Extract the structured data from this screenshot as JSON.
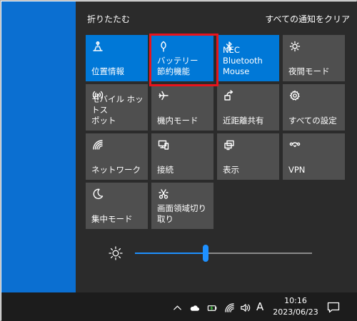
{
  "header": {
    "collapse_label": "折りたたむ",
    "clear_all_label": "すべての通知をクリア"
  },
  "tiles": [
    {
      "label": "位置情報",
      "icon": "location-icon",
      "active": true
    },
    {
      "label": "バッテリー\n節約機能",
      "icon": "battery-saver-icon",
      "active": true
    },
    {
      "label": "NEC Bluetooth\nMouse",
      "icon": "bluetooth-icon",
      "active": true
    },
    {
      "label": "夜間モード",
      "icon": "night-light-icon",
      "active": false
    },
    {
      "label": "モバイル ホットス\nポット",
      "icon": "mobile-hotspot-icon",
      "active": false
    },
    {
      "label": "機内モード",
      "icon": "airplane-icon",
      "active": false
    },
    {
      "label": "近距離共有",
      "icon": "nearby-share-icon",
      "active": false
    },
    {
      "label": "すべての設定",
      "icon": "settings-gear-icon",
      "active": false
    },
    {
      "label": "ネットワーク",
      "icon": "network-icon",
      "active": false
    },
    {
      "label": "接続",
      "icon": "connect-icon",
      "active": false
    },
    {
      "label": "表示",
      "icon": "project-icon",
      "active": false
    },
    {
      "label": "VPN",
      "icon": "vpn-icon",
      "active": false
    },
    {
      "label": "集中モード",
      "icon": "focus-moon-icon",
      "active": false
    },
    {
      "label": "画面領域切り取り",
      "icon": "snip-icon",
      "active": false
    }
  ],
  "brightness": {
    "icon": "brightness-sun-icon",
    "level": 0.4
  },
  "taskbar": {
    "icons": [
      "chevron-up-icon",
      "onedrive-cloud-icon",
      "battery-charging-icon",
      "wifi-icon",
      "volume-icon"
    ],
    "ime_label": "A",
    "time": "10:16",
    "date": "2023/06/23",
    "notification_icon": "notification-center-icon"
  },
  "colors": {
    "accent": "#0078d7",
    "tile_inactive": "#4f4f4f",
    "panel_bg": "#2b2b2b",
    "desktop_bg": "#0b6fd1",
    "highlight": "#e8141c"
  }
}
